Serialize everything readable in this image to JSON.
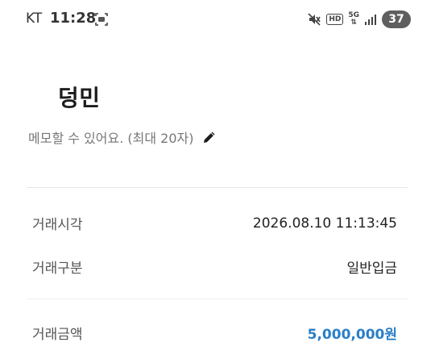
{
  "status_bar": {
    "carrier": "KT",
    "time": "11:28",
    "hd": "HD",
    "network": "5G",
    "battery": "37"
  },
  "profile": {
    "name": "덩민",
    "memo_placeholder": "메모할 수 있어요. (최대 20자)"
  },
  "details": {
    "rows": [
      {
        "label": "거래시각",
        "value": "2026.08.10 11:13:45"
      },
      {
        "label": "거래구분",
        "value": "일반입금"
      },
      {
        "label": "거래금액",
        "value": "5,000,000원"
      }
    ]
  },
  "colors": {
    "amount": "#2a7ec7"
  }
}
